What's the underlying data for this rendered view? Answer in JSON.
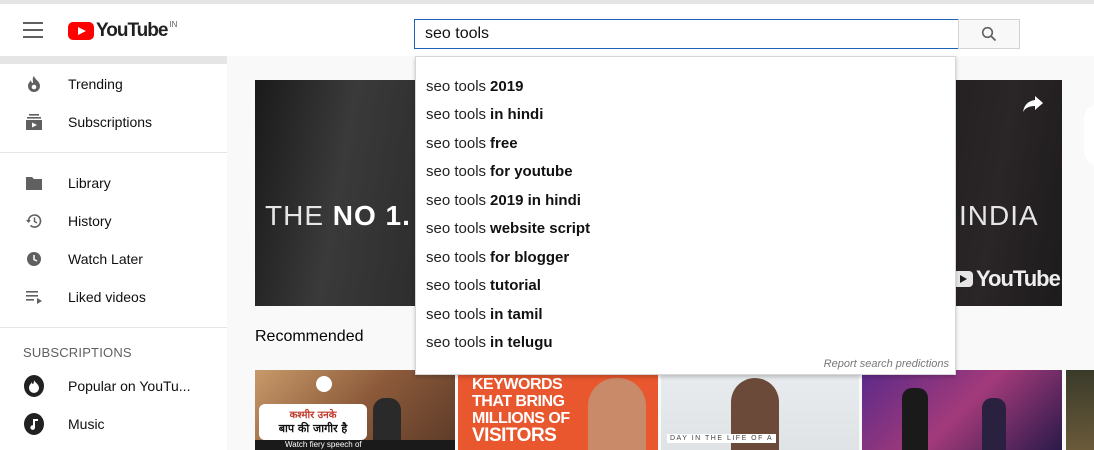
{
  "header": {
    "logo_text": "YouTube",
    "logo_country": "IN",
    "search_value": "seo tools"
  },
  "sidebar": {
    "items": [
      {
        "label": "Trending",
        "icon": "trending-icon"
      },
      {
        "label": "Subscriptions",
        "icon": "subscriptions-icon"
      },
      {
        "label": "Library",
        "icon": "library-icon"
      },
      {
        "label": "History",
        "icon": "history-icon"
      },
      {
        "label": "Watch Later",
        "icon": "watch-later-icon"
      },
      {
        "label": "Liked videos",
        "icon": "liked-videos-icon"
      }
    ],
    "subscriptions_heading": "SUBSCRIPTIONS",
    "subscriptions": [
      {
        "label": "Popular on YouTu..."
      },
      {
        "label": "Music"
      }
    ]
  },
  "suggestions": {
    "prefix": "seo tools",
    "items": [
      {
        "suffix": "2019"
      },
      {
        "suffix": "in hindi"
      },
      {
        "suffix": "free"
      },
      {
        "suffix": "for youtube"
      },
      {
        "suffix": "2019 in hindi"
      },
      {
        "suffix": "website script"
      },
      {
        "suffix": "for blogger"
      },
      {
        "suffix": "tutorial"
      },
      {
        "suffix": "in tamil"
      },
      {
        "suffix": "in telugu"
      }
    ],
    "report_label": "Report search predictions"
  },
  "hero": {
    "title_left_plain": "THE ",
    "title_left_bold": "NO 1.",
    "title_right": "INDIA",
    "logo_text": "YouTube"
  },
  "main": {
    "recommended_title": "Recommended"
  },
  "thumbnails": {
    "t1_line1": "कश्मीर उनके",
    "t1_line2": "बाप की जागीर है",
    "t1_caption": "Watch fiery speech of",
    "t2_text": [
      "KEYWORDS",
      "THAT BRING",
      "MILLIONS OF",
      "VISITORS"
    ],
    "t3_caption": "DAY IN THE LIFE OF A"
  },
  "colors": {
    "brand_red": "#ff0000",
    "search_border": "#1c62b9"
  }
}
